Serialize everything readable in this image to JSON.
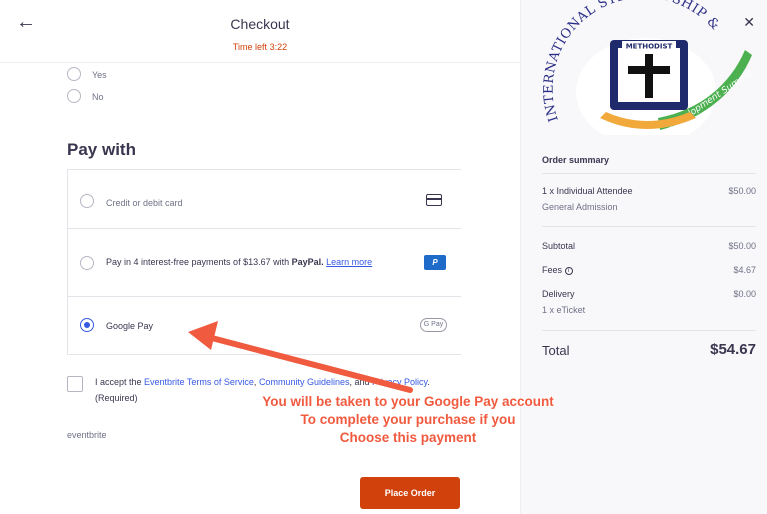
{
  "header": {
    "title": "Checkout",
    "timer": "Time left 3:22"
  },
  "question": {
    "options": [
      {
        "label": "Yes"
      },
      {
        "label": "No"
      }
    ]
  },
  "payment": {
    "heading": "Pay with",
    "card_label": "Credit or debit card",
    "paypal_prefix": "Pay in 4 interest-free payments of $13.67 with ",
    "paypal_brand": "PayPal.",
    "paypal_link": "Learn more",
    "paypal_icon_text": "P",
    "gpay_label": "Google Pay",
    "gpay_icon_text": "G Pay",
    "selected": "Google Pay"
  },
  "terms": {
    "prefix": "I accept the ",
    "tos_link": "Eventbrite Terms of Service",
    "sep1": ", ",
    "community_link": "Community Guidelines",
    "sep2": ", and ",
    "privacy_link": "Privacy Policy",
    "suffix": ". (Required)"
  },
  "footer": {
    "brand": "eventbrite",
    "place_order_label": "Place Order"
  },
  "annotation": {
    "lines": [
      "You will be taken to your Google Pay account",
      "To complete your purchase if you",
      "Choose this payment"
    ],
    "color": "#f05a3f"
  },
  "summary": {
    "title": "Order summary",
    "item": {
      "name": "1 x Individual Attendee",
      "type": "General Admission",
      "price": "$50.00"
    },
    "subtotal_label": "Subtotal",
    "subtotal": "$50.00",
    "fees_label": "Fees",
    "fees": "$4.67",
    "delivery_label": "Delivery",
    "delivery_method": "1 x eTicket",
    "delivery": "$0.00",
    "total_label": "Total",
    "total": "$54.67"
  },
  "logo": {
    "text_top": "INTERNATIONAL STEWARDSHIP &",
    "text_ribbon": "Development Summit",
    "text_banner": "METHODIST"
  },
  "colors": {
    "accent": "#d1410c",
    "link": "#3659e3",
    "text": "#39364f"
  }
}
